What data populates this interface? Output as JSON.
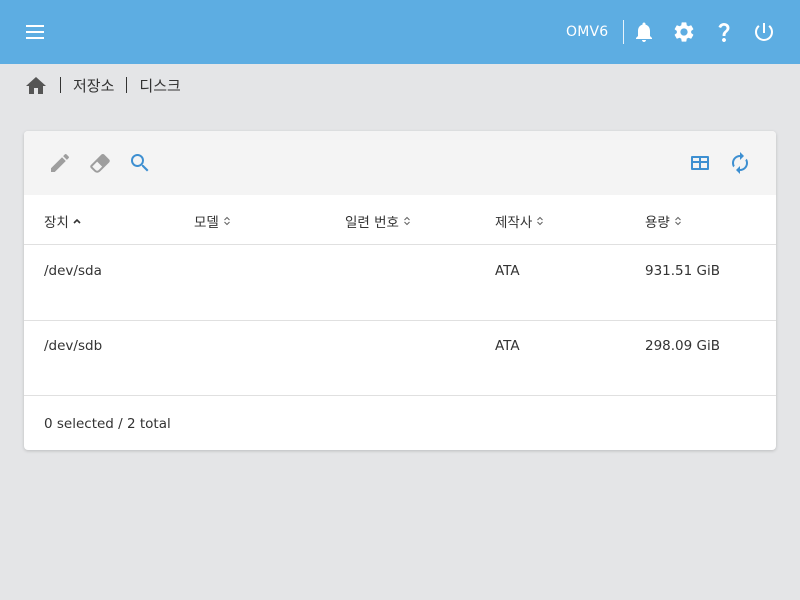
{
  "header": {
    "hostname": "OMV6",
    "icons": [
      "menu-icon",
      "bell-icon",
      "gear-icon",
      "help-icon",
      "power-icon"
    ],
    "accent_color": "#5dade2"
  },
  "breadcrumb": {
    "items": [
      "저장소",
      "디스크"
    ]
  },
  "toolbar": {
    "icons": [
      "pencil-icon",
      "eraser-icon",
      "search-icon",
      "table-columns-icon",
      "refresh-icon"
    ]
  },
  "table": {
    "columns": [
      "장치",
      "모델",
      "일련 번호",
      "제작사",
      "용량"
    ],
    "rows": [
      {
        "device": "/dev/sda",
        "model": "",
        "serial": "",
        "vendor": "ATA",
        "capacity": "931.51 GiB"
      },
      {
        "device": "/dev/sdb",
        "model": "",
        "serial": "",
        "vendor": "ATA",
        "capacity": "298.09 GiB"
      }
    ],
    "footer": "0 selected / 2 total"
  }
}
